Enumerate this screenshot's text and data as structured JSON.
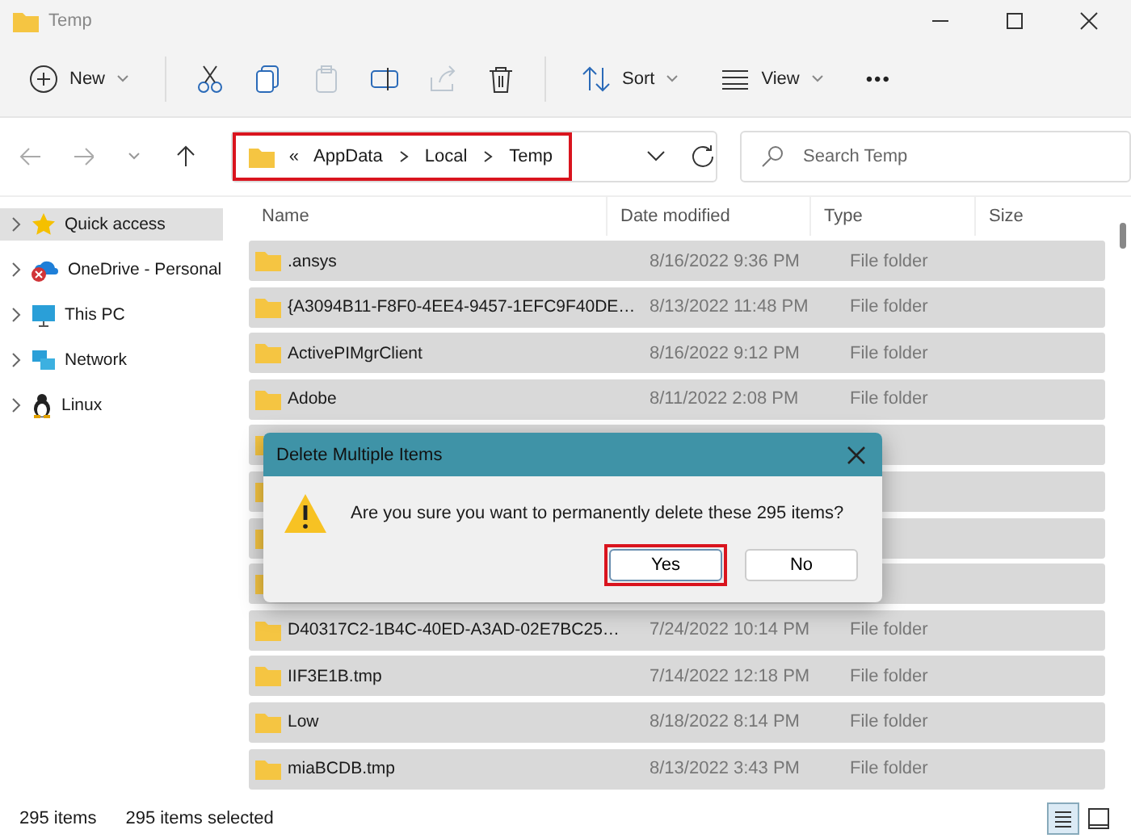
{
  "window": {
    "title": "Temp"
  },
  "toolbar": {
    "new_label": "New",
    "sort_label": "Sort",
    "view_label": "View",
    "more": "•••"
  },
  "address": {
    "prefix": "«",
    "crumbs": [
      "AppData",
      "Local",
      "Temp"
    ],
    "highlighted": true
  },
  "search": {
    "placeholder": "Search Temp"
  },
  "sidebar": {
    "items": [
      {
        "label": "Quick access",
        "kind": "star",
        "selected": true
      },
      {
        "label": "OneDrive - Personal",
        "kind": "cloud",
        "selected": false
      },
      {
        "label": "This PC",
        "kind": "pc",
        "selected": false
      },
      {
        "label": "Network",
        "kind": "network",
        "selected": false
      },
      {
        "label": "Linux",
        "kind": "penguin",
        "selected": false
      }
    ]
  },
  "table": {
    "columns": [
      "Name",
      "Date modified",
      "Type",
      "Size"
    ],
    "rows": [
      {
        "kind": "file",
        "name": ".ansys",
        "date": "8/16/2022 9:36 PM",
        "type": "File folder",
        "selected": true
      },
      {
        "kind": "file",
        "name": "{A3094B11-F8F0-4EE4-9457-1EFC9F40DE…",
        "date": "8/13/2022 11:48 PM",
        "type": "File folder",
        "selected": true
      },
      {
        "kind": "file",
        "name": "ActivePIMgrClient",
        "date": "8/16/2022 9:12 PM",
        "type": "File folder",
        "selected": true
      },
      {
        "kind": "file",
        "name": "Adobe",
        "date": "8/11/2022 2:08 PM",
        "type": "File folder",
        "selected": true
      },
      {
        "kind": "covered",
        "selected": true
      },
      {
        "kind": "covered",
        "selected": true
      },
      {
        "kind": "covered",
        "selected": true
      },
      {
        "kind": "covered",
        "selected": true
      },
      {
        "kind": "file",
        "name": "D40317C2-1B4C-40ED-A3AD-02E7BC25…",
        "date": "7/24/2022 10:14 PM",
        "type": "File folder",
        "selected": true
      },
      {
        "kind": "file",
        "name": "IIF3E1B.tmp",
        "date": "7/14/2022 12:18 PM",
        "type": "File folder",
        "selected": true
      },
      {
        "kind": "file",
        "name": "Low",
        "date": "8/18/2022 8:14 PM",
        "type": "File folder",
        "selected": true
      },
      {
        "kind": "file",
        "name": "miaBCDB.tmp",
        "date": "8/13/2022 3:43 PM",
        "type": "File folder",
        "selected": true
      }
    ]
  },
  "dialog": {
    "title": "Delete Multiple Items",
    "message": "Are you sure you want to permanently delete these 295 items?",
    "buttons": [
      {
        "label": "Yes",
        "highlighted": true
      },
      {
        "label": "No",
        "highlighted": false
      }
    ]
  },
  "status_bar": {
    "count": "295 items",
    "selection": "295 items selected"
  }
}
